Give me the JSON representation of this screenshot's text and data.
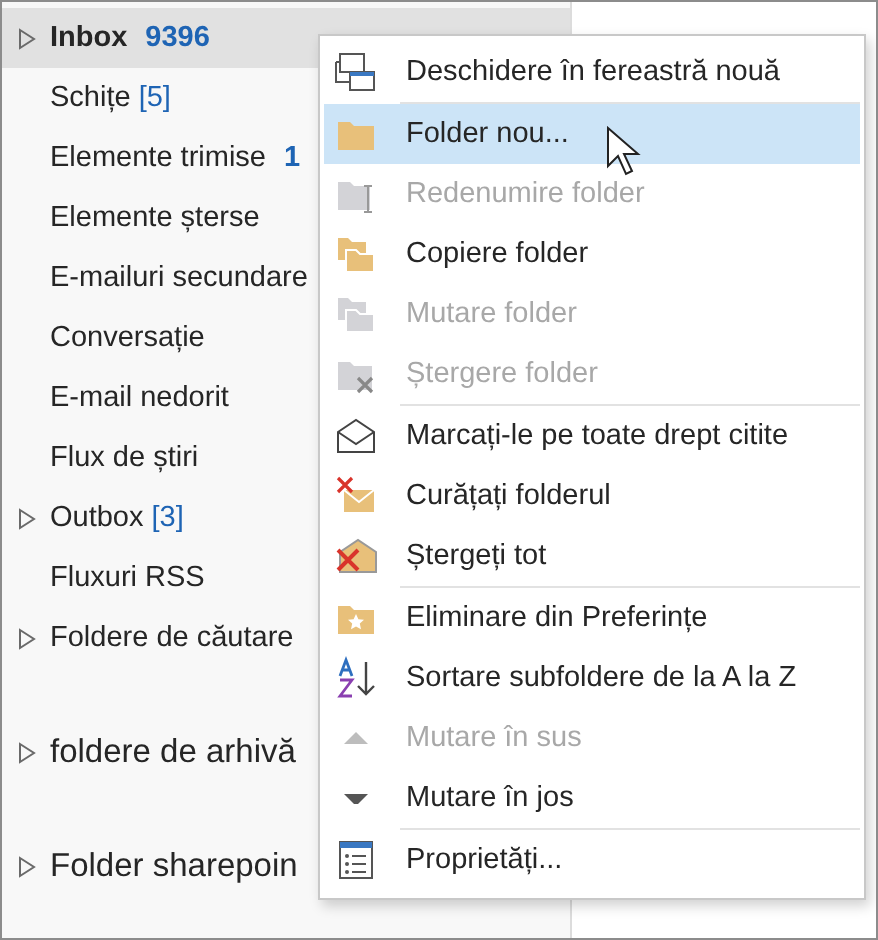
{
  "folders": [
    {
      "label": "Inbox",
      "count": "9396",
      "count_bold": true,
      "expandable": true,
      "selected": true,
      "kind": "folder"
    },
    {
      "label": "Schițe",
      "count": "[5]",
      "count_bold": false,
      "expandable": false,
      "selected": false,
      "kind": "folder"
    },
    {
      "label": "Elemente trimise",
      "count": "1",
      "count_bold": true,
      "expandable": false,
      "selected": false,
      "kind": "folder"
    },
    {
      "label": "Elemente șterse",
      "expandable": false,
      "selected": false,
      "kind": "folder"
    },
    {
      "label": "E-mailuri secundare",
      "expandable": false,
      "selected": false,
      "kind": "folder"
    },
    {
      "label": "Conversație",
      "expandable": false,
      "selected": false,
      "kind": "folder"
    },
    {
      "label": "E-mail nedorit",
      "expandable": false,
      "selected": false,
      "kind": "folder"
    },
    {
      "label": "Flux de știri",
      "expandable": false,
      "selected": false,
      "kind": "folder"
    },
    {
      "label": "Outbox",
      "count": "[3]",
      "count_bold": false,
      "expandable": true,
      "selected": false,
      "kind": "folder"
    },
    {
      "label": "Fluxuri RSS",
      "expandable": false,
      "selected": false,
      "kind": "folder"
    },
    {
      "label": "Foldere de căutare",
      "expandable": true,
      "selected": false,
      "kind": "folder"
    },
    {
      "label": "foldere de arhivă",
      "expandable": true,
      "selected": false,
      "kind": "account"
    },
    {
      "label": "Folder sharepoin",
      "expandable": true,
      "selected": false,
      "kind": "account"
    }
  ],
  "context_menu": {
    "items": [
      {
        "label": "Deschidere în fereastră nouă",
        "disabled": false,
        "selected": false,
        "separator_after": true
      },
      {
        "label": "Folder nou...",
        "disabled": false,
        "selected": true,
        "separator_after": false
      },
      {
        "label": "Redenumire folder",
        "disabled": true,
        "selected": false,
        "separator_after": false
      },
      {
        "label": "Copiere folder",
        "disabled": false,
        "selected": false,
        "separator_after": false
      },
      {
        "label": "Mutare folder",
        "disabled": true,
        "selected": false,
        "separator_after": false
      },
      {
        "label": "Ștergere folder",
        "disabled": true,
        "selected": false,
        "separator_after": true
      },
      {
        "label": "Marcați-le pe toate drept citite",
        "disabled": false,
        "selected": false,
        "separator_after": false
      },
      {
        "label": "Curățați folderul",
        "disabled": false,
        "selected": false,
        "separator_after": false
      },
      {
        "label": "Ștergeți tot",
        "disabled": false,
        "selected": false,
        "separator_after": true
      },
      {
        "label": "Eliminare din Preferințe",
        "disabled": false,
        "selected": false,
        "separator_after": false
      },
      {
        "label": "Sortare subfoldere de la A la Z",
        "disabled": false,
        "selected": false,
        "separator_after": false
      },
      {
        "label": "Mutare în sus",
        "disabled": true,
        "selected": false,
        "separator_after": false
      },
      {
        "label": "Mutare în jos",
        "disabled": false,
        "selected": false,
        "separator_after": true
      },
      {
        "label": "Proprietăți...",
        "disabled": false,
        "selected": false,
        "separator_after": false
      }
    ]
  }
}
